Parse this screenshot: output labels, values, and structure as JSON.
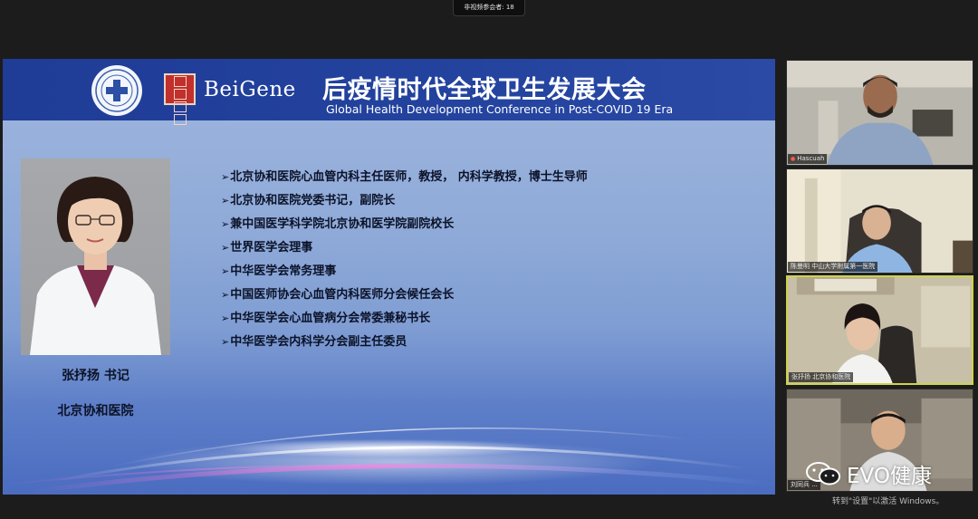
{
  "meeting": {
    "participant_count_label": "非视频参会者: 18"
  },
  "slide": {
    "brand": "BeiGene",
    "title_cn": "后疫情时代全球卫生发展大会",
    "title_en": "Global Health Development Conference in Post-COVID 19 Era",
    "speaker_name": "张抒扬 书记",
    "speaker_org": "北京协和医院",
    "credentials": [
      "北京协和医院心血管内科主任医师，教授， 内科学教授，博士生导师",
      "北京协和医院党委书记，副院长",
      "兼中国医学科学院北京协和医学院副院校长",
      "世界医学会理事",
      "中华医学会常务理事",
      "中国医师协会心血管内科医师分会候任会长",
      "中华医学会心血管病分会常委兼秘书长",
      "中华医学会内科学分会副主任委员"
    ]
  },
  "participants": [
    {
      "name": "Hascuah"
    },
    {
      "name": "陈曼明 中山大学附属第一医院"
    },
    {
      "name": "张抒扬 北京协和医院"
    },
    {
      "name": "刘同兵 ..."
    }
  ],
  "watermark": {
    "text": "EVO健康"
  },
  "system_notice": "转到\"设置\"以激活 Windows。",
  "colors": {
    "header_blue": "#23439f",
    "active_speaker_border": "#cfd34a",
    "muted_mic": "#ff5b4a"
  }
}
